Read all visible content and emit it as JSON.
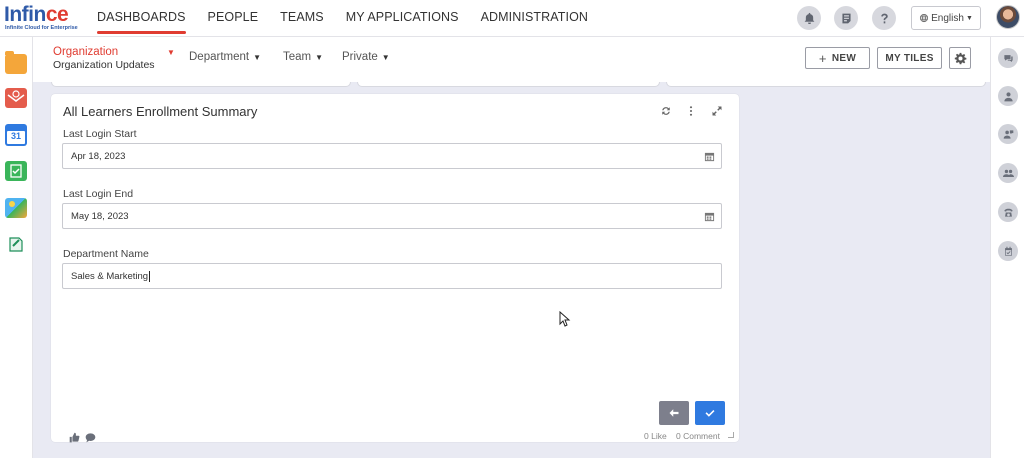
{
  "brand": {
    "logo_word_blue": "Infin",
    "logo_word_red": "ce",
    "tagline": "Infinite Cloud for Enterprise"
  },
  "nav": {
    "items": [
      {
        "label": "DASHBOARDS",
        "active": true
      },
      {
        "label": "PEOPLE",
        "active": false
      },
      {
        "label": "TEAMS",
        "active": false
      },
      {
        "label": "MY APPLICATIONS",
        "active": false
      },
      {
        "label": "ADMINISTRATION",
        "active": false
      }
    ]
  },
  "header_icons": [
    "bell-icon",
    "news-icon",
    "help-icon"
  ],
  "language": {
    "label": "English",
    "icon": "globe-icon"
  },
  "subnav": {
    "org_label": "Organization",
    "org_sub": "Organization Updates",
    "department": "Department",
    "team": "Team",
    "private": "Private",
    "new_button": "NEW",
    "my_tiles_button": "MY TILES"
  },
  "card": {
    "title": "All Learners Enrollment Summary",
    "fields": [
      {
        "label": "Last Login Start",
        "value": "Apr 18, 2023"
      },
      {
        "label": "Last Login End",
        "value": "May 18, 2023"
      },
      {
        "label": "Department Name",
        "value": "Sales & Marketing"
      }
    ],
    "likes": "0 Like",
    "comments": "0 Comment"
  },
  "left_apps": [
    "folder-icon",
    "mail-icon",
    "calendar-icon",
    "tasks-icon",
    "photos-icon",
    "forms-icon"
  ],
  "calendar_day": "31",
  "right_rail": [
    "chat-icon",
    "person-icon",
    "person-chat-icon",
    "group-icon",
    "phone-icon",
    "calendar-check-icon"
  ],
  "colors": {
    "accent_red": "#e03c31",
    "primary_blue": "#2f7ae0",
    "background": "#e9eaf3"
  }
}
